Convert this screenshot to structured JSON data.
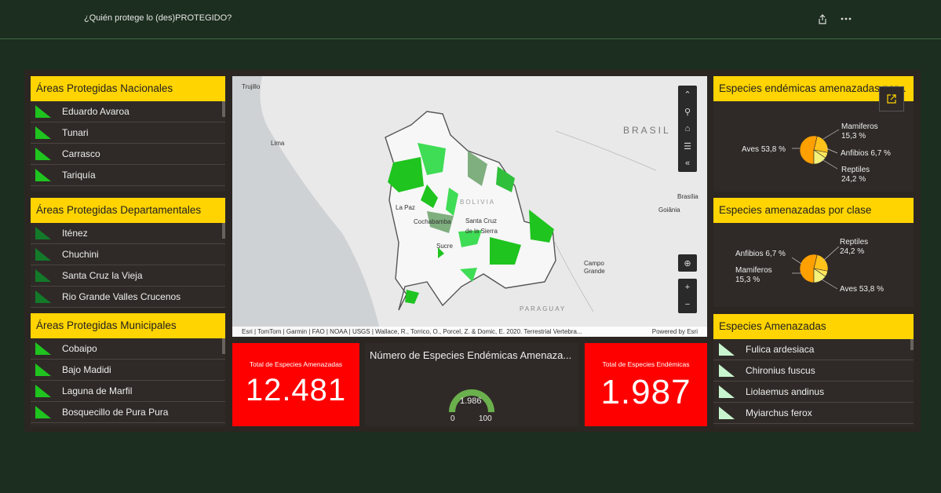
{
  "header": {
    "title": "¿Quién protege lo (des)PROTEGIDO?"
  },
  "panels": {
    "nacionales": {
      "title": "Áreas Protegidas Nacionales",
      "items": [
        "Eduardo Avaroa",
        "Tunari",
        "Carrasco",
        "Tariquía"
      ]
    },
    "departamentales": {
      "title": "Áreas Protegidas Departamentales",
      "items": [
        "Iténez",
        "Chuchini",
        "Santa Cruz la Vieja",
        "Rio Grande Valles Crucenos"
      ]
    },
    "municipales": {
      "title": "Áreas Protegidas Municipales",
      "items": [
        "Cobaipo",
        "Bajo Madidi",
        "Laguna de Marfil",
        "Bosquecillo de Pura Pura"
      ]
    },
    "endemicas": {
      "title": "Especies endémicas amenazadas por...",
      "slices": [
        {
          "label": "Aves 53,8 %",
          "value": 53.8,
          "color": "#ff9f00"
        },
        {
          "label": "Reptiles",
          "label2": "24,2 %",
          "value": 24.2,
          "color": "#ffc21a"
        },
        {
          "label": "Anfibios 6,7 %",
          "value": 6.7,
          "color": "#ffe55a"
        },
        {
          "label": "Mamiferos",
          "label2": "15,3 %",
          "value": 15.3,
          "color": "#f3f17a"
        }
      ]
    },
    "clase": {
      "title": "Especies amenazadas por clase",
      "slices": [
        {
          "label": "Aves 53,8 %",
          "value": 53.8,
          "color": "#ff9f00"
        },
        {
          "label": "Reptiles",
          "label2": "24,2 %",
          "value": 24.2,
          "color": "#ffc21a"
        },
        {
          "label": "Anfibios 6,7 %",
          "value": 6.7,
          "color": "#ffe55a"
        },
        {
          "label": "Mamiferos",
          "label2": "15,3 %",
          "value": 15.3,
          "color": "#f3f17a"
        }
      ]
    },
    "amenazadas": {
      "title": "Especies Amenazadas",
      "items": [
        "Fulica ardesiaca",
        "Chironius fuscus",
        "Liolaemus andinus",
        "Myiarchus ferox"
      ]
    }
  },
  "stats": {
    "total_amenazadas": {
      "label": "Total de Especies Amenazadas",
      "value": "12.481"
    },
    "total_endemicas": {
      "label": "Total de Especies Endémicas",
      "value": "1.987"
    }
  },
  "gauge": {
    "title": "Número de Especies Endémicas Amenaza...",
    "value": "1.986",
    "min": "0",
    "max": "100",
    "fill_fraction": 1
  },
  "map": {
    "labels": {
      "trujillo": "Trujillo",
      "lima": "Lima",
      "brasil": "BRASIL",
      "bolivia": "BOLIVIA",
      "lapaz": "La Paz",
      "cochabamba": "Cochabamba",
      "santacruz": "Santa Cruz",
      "delasierra": "de la Sierra",
      "sucre": "Sucre",
      "brasilia": "Brasília",
      "goiania": "Goiânia",
      "campo": "Campo",
      "grande": "Grande",
      "paraguay": "PARAGUAY"
    },
    "attribution": "Esri | TomTom | Garmin | FAO | NOAA | USGS | Wallace, R., Torrico, O., Porcel, Z. & Domic, E. 2020. Terrestrial Vertebra...",
    "powered": "Powered by Esri"
  },
  "colors": {
    "accent": "#ffd400",
    "stat_bg": "#ff0000",
    "area_green": "#1fc41f",
    "gauge": "#6ab04c"
  }
}
